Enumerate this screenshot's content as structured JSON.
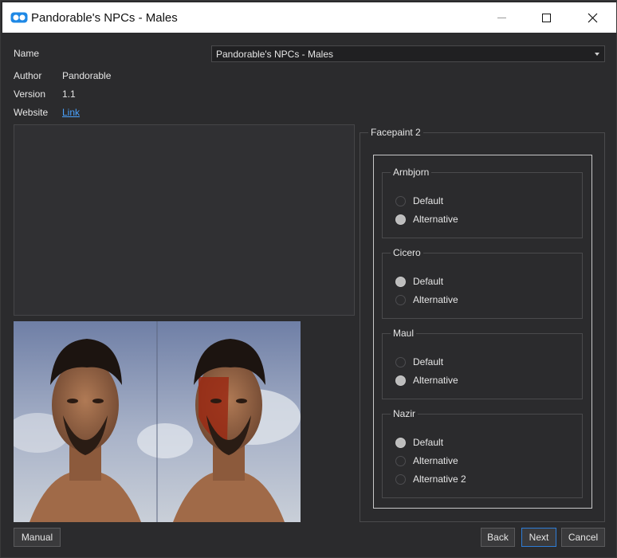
{
  "window": {
    "title": "Pandorable's NPCs - Males"
  },
  "info": {
    "name_label": "Name",
    "name_value": "Pandorable's NPCs - Males",
    "author_label": "Author",
    "author_value": "Pandorable",
    "version_label": "Version",
    "version_value": "1.1",
    "website_label": "Website",
    "website_value": "Link"
  },
  "options": {
    "group_title": "Facepaint 2",
    "groups": [
      {
        "title": "Arnbjorn",
        "options": [
          {
            "label": "Default",
            "checked": false
          },
          {
            "label": "Alternative",
            "checked": true
          }
        ]
      },
      {
        "title": "Cicero",
        "options": [
          {
            "label": "Default",
            "checked": true
          },
          {
            "label": "Alternative",
            "checked": false
          }
        ]
      },
      {
        "title": "Maul",
        "options": [
          {
            "label": "Default",
            "checked": false
          },
          {
            "label": "Alternative",
            "checked": true
          }
        ]
      },
      {
        "title": "Nazir",
        "options": [
          {
            "label": "Default",
            "checked": true
          },
          {
            "label": "Alternative",
            "checked": false
          },
          {
            "label": "Alternative 2",
            "checked": false
          }
        ]
      }
    ]
  },
  "buttons": {
    "manual": "Manual",
    "back": "Back",
    "next": "Next",
    "cancel": "Cancel"
  },
  "colors": {
    "accent": "#2e7dd7",
    "link": "#4aa3ff",
    "background": "#2b2b2d"
  }
}
